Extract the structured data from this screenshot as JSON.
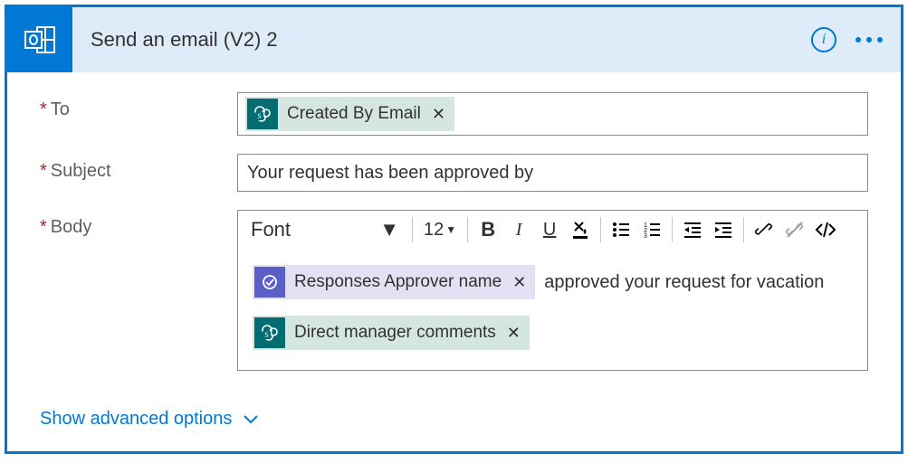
{
  "header": {
    "title": "Send an email (V2) 2"
  },
  "labels": {
    "to": "To",
    "subject": "Subject",
    "body": "Body"
  },
  "to": {
    "tokens": [
      {
        "label": "Created By Email",
        "source": "sp"
      }
    ]
  },
  "subject": {
    "value": "Your request has been approved by"
  },
  "toolbar": {
    "font": "Font",
    "size": "12"
  },
  "body": {
    "lines": [
      {
        "tokens": [
          {
            "label": "Responses Approver name",
            "source": "ap"
          }
        ],
        "text": "approved your request for vacation"
      },
      {
        "tokens": [
          {
            "label": "Direct manager comments",
            "source": "sp"
          }
        ],
        "text": ""
      }
    ]
  },
  "footer": {
    "advanced": "Show advanced options"
  }
}
